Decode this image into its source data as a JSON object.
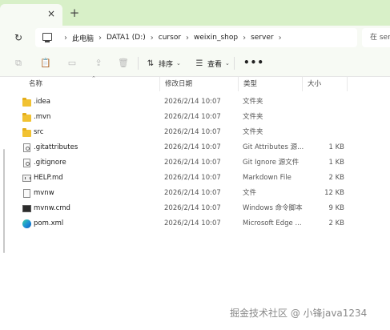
{
  "tab": {
    "close_icon": "×",
    "new_icon": "+"
  },
  "address": {
    "refresh_icon": "↻",
    "sep": "›",
    "crumbs": [
      "此电脑",
      "DATA1 (D:)",
      "cursor",
      "weixin_shop",
      "server"
    ],
    "search_placeholder": "在 ser"
  },
  "toolbar": {
    "sort_label": "排序",
    "view_label": "查看",
    "more_label": "•••",
    "caret": "⌄"
  },
  "columns": {
    "name": "名称",
    "date": "修改日期",
    "type": "类型",
    "size": "大小",
    "sort_arrow": "⌃"
  },
  "files": [
    {
      "icon": "folder-icon",
      "name": ".idea",
      "date": "2026/2/14 10:07",
      "type": "文件夹",
      "size": ""
    },
    {
      "icon": "folder-icon",
      "name": ".mvn",
      "date": "2026/2/14 10:07",
      "type": "文件夹",
      "size": ""
    },
    {
      "icon": "folder-icon",
      "name": "src",
      "date": "2026/2/14 10:07",
      "type": "文件夹",
      "size": ""
    },
    {
      "icon": "settings-file-icon",
      "name": ".gitattributes",
      "date": "2026/2/14 10:07",
      "type": "Git Attributes 源...",
      "size": "1 KB"
    },
    {
      "icon": "settings-file-icon",
      "name": ".gitignore",
      "date": "2026/2/14 10:07",
      "type": "Git Ignore 源文件",
      "size": "1 KB"
    },
    {
      "icon": "markdown-file-icon",
      "name": "HELP.md",
      "date": "2026/2/14 10:07",
      "type": "Markdown File",
      "size": "2 KB"
    },
    {
      "icon": "file-icon",
      "name": "mvnw",
      "date": "2026/2/14 10:07",
      "type": "文件",
      "size": "12 KB"
    },
    {
      "icon": "cmd-file-icon",
      "name": "mvnw.cmd",
      "date": "2026/2/14 10:07",
      "type": "Windows 命令脚本",
      "size": "9 KB"
    },
    {
      "icon": "edge-file-icon",
      "name": "pom.xml",
      "date": "2026/2/14 10:07",
      "type": "Microsoft Edge ...",
      "size": "2 KB"
    }
  ],
  "watermark": "掘金技术社区 @ 小锋java1234",
  "colors": {
    "tab_strip": "#d8f0c8",
    "chrome_bg": "#f7faf4",
    "folder": "#f1c232"
  }
}
